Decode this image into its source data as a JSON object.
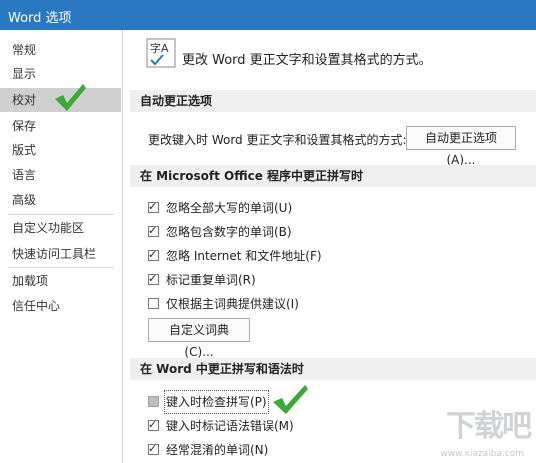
{
  "window": {
    "title": "Word 选项"
  },
  "sidebar": {
    "items": [
      {
        "label": "常规"
      },
      {
        "label": "显示"
      },
      {
        "label": "校对",
        "selected": true
      },
      {
        "label": "保存"
      },
      {
        "label": "版式"
      },
      {
        "label": "语言"
      },
      {
        "label": "高级"
      },
      {
        "label": "自定义功能区"
      },
      {
        "label": "快速访问工具栏"
      },
      {
        "label": "加载项"
      },
      {
        "label": "信任中心"
      }
    ]
  },
  "main": {
    "header": {
      "text": "更改 Word 更正文字和设置其格式的方式。",
      "icon": "abc-check-icon",
      "icon_text": "字A"
    },
    "autocorrect": {
      "section_title": "自动更正选项",
      "description": "更改键入时 Word 更正文字和设置其格式的方式:",
      "button_label": "自动更正选项(A)..."
    },
    "office_spelling": {
      "section_title": "在 Microsoft Office 程序中更正拼写时",
      "options": [
        {
          "label": "忽略全部大写的单词(U)",
          "checked": true
        },
        {
          "label": "忽略包含数字的单词(B)",
          "checked": true
        },
        {
          "label": "忽略 Internet 和文件地址(F)",
          "checked": true
        },
        {
          "label": "标记重复单词(R)",
          "checked": true
        },
        {
          "label": "仅根据主词典提供建议(I)",
          "checked": false
        }
      ],
      "button_label": "自定义词典(C)..."
    },
    "word_spelling": {
      "section_title": "在 Word 中更正拼写和语法时",
      "options": [
        {
          "label": "键入时检查拼写(P)",
          "checked": false,
          "state": "unchecked-gray"
        },
        {
          "label": "键入时标记语法错误(M)",
          "checked": true
        },
        {
          "label": "经常混淆的单词(N)",
          "checked": true
        }
      ]
    }
  },
  "annotations": {
    "checkmark_color": "#3aa935"
  },
  "colors": {
    "titlebar": "#2b78c2",
    "selected_item": "#cfcfcf",
    "section_bg": "#efefef"
  },
  "watermark": {
    "text": "下载吧",
    "url": "www.xiazaiba.com"
  }
}
